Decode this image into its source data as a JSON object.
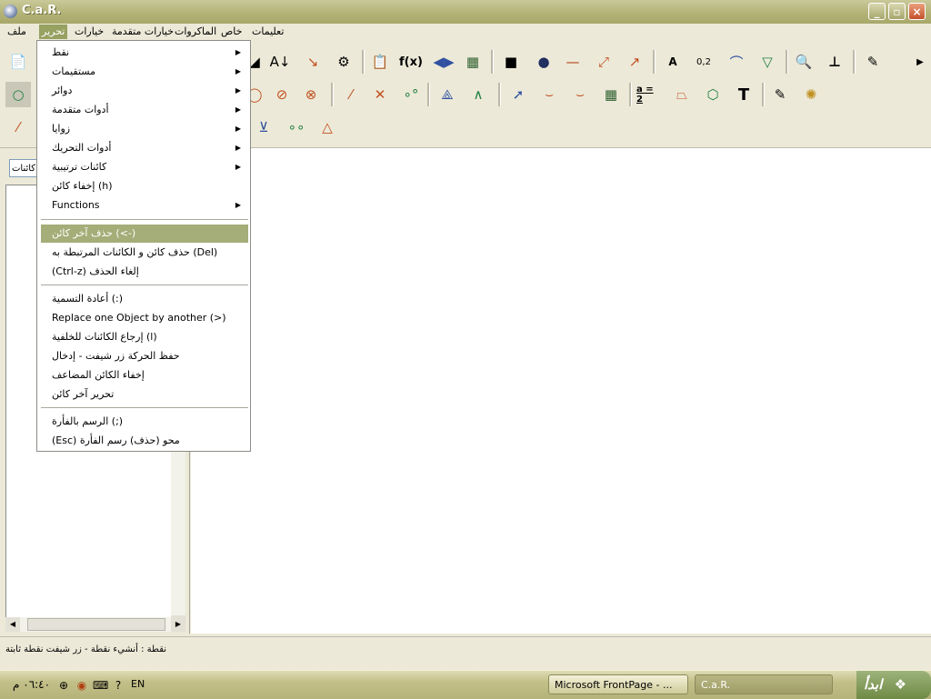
{
  "window": {
    "title": "C.a.R."
  },
  "menubar": [
    {
      "id": "file",
      "label": "ملف"
    },
    {
      "id": "edit",
      "label": "تحرير"
    },
    {
      "id": "options",
      "label": "خيارات"
    },
    {
      "id": "advanced",
      "label": "خيارات متقدمة"
    },
    {
      "id": "macros",
      "label": "الماكروات"
    },
    {
      "id": "special",
      "label": "خاص"
    },
    {
      "id": "help",
      "label": "تعليمات"
    }
  ],
  "dropdown": {
    "items": [
      {
        "label": "نقط",
        "submenu": true
      },
      {
        "label": "مستقيمات",
        "submenu": true
      },
      {
        "label": "دوائر",
        "submenu": true
      },
      {
        "label": "أدوات متقدمة",
        "submenu": true
      },
      {
        "label": "زوايا",
        "submenu": true
      },
      {
        "label": "أدوات التحريك",
        "submenu": true
      },
      {
        "label": "كائنات ترتيبية",
        "submenu": true
      },
      {
        "label": "إخفاء كائن (h)",
        "submenu": false
      },
      {
        "label": "Functions",
        "submenu": true
      },
      {
        "label": "حذف آخر كائن     (<-)",
        "submenu": false,
        "highlight": true
      },
      {
        "label": "حذف كائن و الكائنات المرتبطة به (Del)",
        "submenu": false
      },
      {
        "label": "(Ctrl-z)        إلغاء الحذف",
        "submenu": false
      },
      {
        "label": "أعادة التسمية (:)",
        "submenu": false
      },
      {
        "label": "Replace one Object by another (>)",
        "submenu": false
      },
      {
        "label": "إرجاع الكائنات للخلفية (l)",
        "submenu": false
      },
      {
        "label": "حفظ الحركة زر شيفت - إدخال",
        "submenu": false
      },
      {
        "label": "إخفاء الكائن المضاعف",
        "submenu": false
      },
      {
        "label": "تحرير آخر كائن",
        "submenu": false
      },
      {
        "label": "الرسم بالفأرة (;)",
        "submenu": false
      },
      {
        "label": "(Esc)     محو (حذف) رسم الفأرة",
        "submenu": false
      }
    ]
  },
  "toolbar": {
    "labels": {
      "fx": "f(x)",
      "a_label": "A",
      "zero_two": "0,2",
      "a_eq_2": "a = 2",
      "text_tool": "T"
    }
  },
  "leftpanel": {
    "filter_value": "كائنات"
  },
  "status": {
    "text": "نقطة : أنشيء نقطة - زر شيفت نقطة ثابتة"
  },
  "taskbar": {
    "clock": "٠٦:٤٠ م",
    "lang": "EN",
    "tasks": [
      {
        "label": "Microsoft FrontPage - ..."
      },
      {
        "label": "C.a.R."
      }
    ],
    "start_label": "ابدأ"
  },
  "colors": {
    "highlight": "#a5ad78",
    "menu_active": "#97a161",
    "tool_accent": "#c05020"
  }
}
